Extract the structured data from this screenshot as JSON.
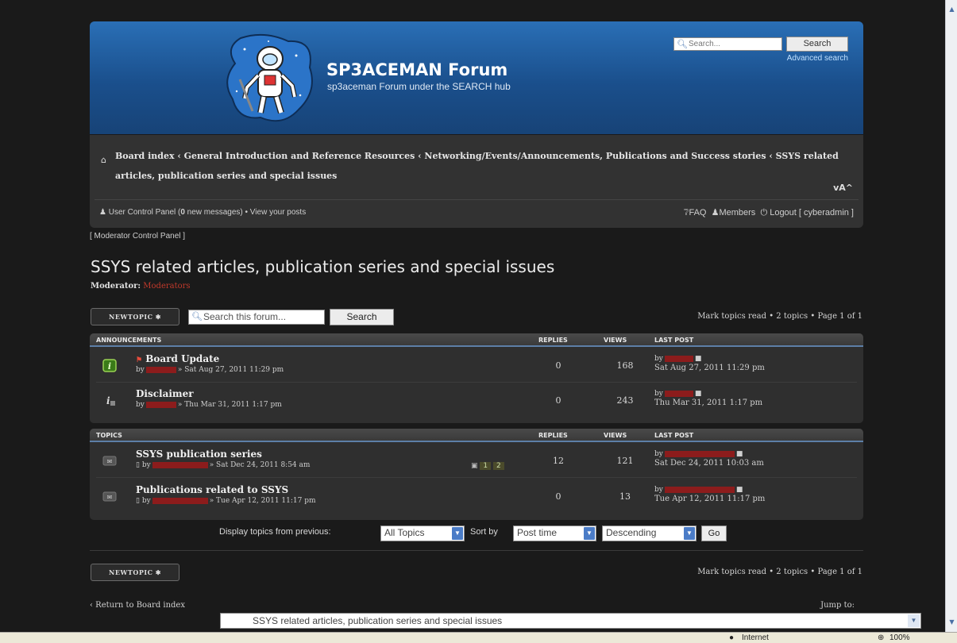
{
  "header": {
    "site_title": "SP3ACEMAN Forum",
    "site_description": "sp3aceman Forum under the SEARCH hub",
    "search_placeholder": "Search...",
    "search_button": "Search",
    "advanced_search": "Advanced search"
  },
  "breadcrumb": {
    "items": [
      "Board index",
      "General Introduction and Reference Resources",
      "Networking/Events/Announcements, Publications and Success stories",
      "SSYS related articles, publication series and special issues"
    ],
    "separator": "‹",
    "font_resize": "vA^"
  },
  "usernav": {
    "ucp_prefix": "User Control Panel (",
    "ucp_count": "0",
    "ucp_suffix": " new messages)",
    "dot": "•",
    "view_posts": "View your posts",
    "faq": "FAQ",
    "members": "Members",
    "logout": "Logout [ cyberadmin ]"
  },
  "mcp": "[ Moderator Control Panel ]",
  "forum": {
    "title": "SSYS related articles, publication series and special issues",
    "moderator_label": "Moderator:",
    "moderator_value": "Moderators"
  },
  "actions": {
    "new_topic": "NEWTOPIC ✱",
    "search_forum_placeholder": "Search this forum...",
    "search_button": "Search",
    "pagination": "Mark topics read • 2 topics • Page 1 of 1"
  },
  "announcements": {
    "header": "ANNOUNCEMENTS",
    "col_replies": "REPLIES",
    "col_views": "VIEWS",
    "col_last_post": "LAST POST",
    "rows": [
      {
        "title": "Board Update",
        "by": "by",
        "date": "» Sat Aug 27, 2011 11:29 pm",
        "replies": "0",
        "views": "168",
        "lp_by": "by",
        "lp_date": "Sat Aug 27, 2011 11:29 pm"
      },
      {
        "title": "Disclaimer",
        "by": "by",
        "date": "» Thu Mar 31, 2011 1:17 pm",
        "replies": "0",
        "views": "243",
        "lp_by": "by",
        "lp_date": "Thu Mar 31, 2011 1:17 pm"
      }
    ]
  },
  "topics": {
    "header": "TOPICS",
    "col_replies": "REPLIES",
    "col_views": "VIEWS",
    "col_last_post": "LAST POST",
    "rows": [
      {
        "title": "SSYS publication series",
        "by": "by",
        "date": "» Sat Dec 24, 2011 8:54 am",
        "pages": [
          "1",
          "2"
        ],
        "replies": "12",
        "views": "121",
        "lp_by": "by",
        "lp_date": "Sat Dec 24, 2011 10:03 am"
      },
      {
        "title": "Publications related to SSYS",
        "by": "by",
        "date": "» Tue Apr 12, 2011 11:17 pm",
        "replies": "0",
        "views": "13",
        "lp_by": "by",
        "lp_date": "Tue Apr 12, 2011 11:17 pm"
      }
    ]
  },
  "display": {
    "label": "Display topics from previous:",
    "period": "All Topics",
    "sort_label": "Sort by",
    "sort_key": "Post time",
    "sort_dir": "Descending",
    "go": "Go"
  },
  "bottom": {
    "new_topic": "NEWTOPIC ✱",
    "pagination": "Mark topics read • 2 topics • Page 1 of 1",
    "return": "‹ Return to Board index",
    "jump_label": "Jump to:",
    "jump_value": "SSYS related articles, publication series and special issues"
  },
  "status_bar": {
    "zone": "Internet",
    "zoom": "100%"
  }
}
